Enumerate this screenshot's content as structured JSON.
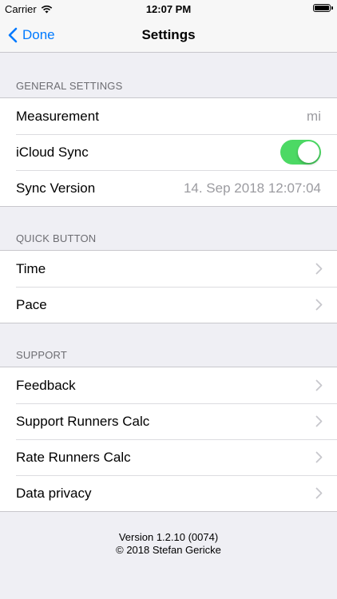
{
  "status": {
    "carrier": "Carrier",
    "time": "12:07 PM"
  },
  "nav": {
    "back_label": "Done",
    "title": "Settings"
  },
  "general": {
    "header": "GENERAL SETTINGS",
    "measurement_label": "Measurement",
    "measurement_value": "mi",
    "icloud_label": "iCloud Sync",
    "icloud_on": true,
    "sync_version_label": "Sync Version",
    "sync_version_value": "14. Sep 2018 12:07:04"
  },
  "quick": {
    "header": "QUICK BUTTON",
    "items": [
      "Time",
      "Pace"
    ]
  },
  "support": {
    "header": "SUPPORT",
    "items": [
      "Feedback",
      "Support Runners Calc",
      "Rate Runners Calc",
      "Data privacy"
    ]
  },
  "footer": {
    "version": "Version 1.2.10 (0074)",
    "copyright": "© 2018 Stefan Gericke"
  },
  "colors": {
    "accent": "#007aff",
    "toggle_on": "#4cd964",
    "background": "#efeff4"
  }
}
